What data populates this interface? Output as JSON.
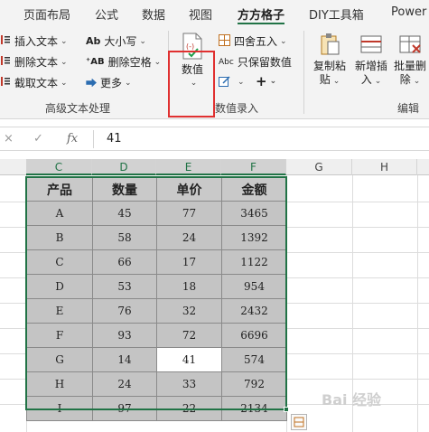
{
  "ribbon_tabs": [
    "页面布局",
    "公式",
    "数据",
    "视图",
    "方方格子",
    "DIY工具箱",
    "Power"
  ],
  "active_tab": "方方格子",
  "text_group": {
    "insert_text": "插入文本",
    "delete_text": "删除文本",
    "cut_text": "截取文本",
    "case": "大小写",
    "delete_spaces": "删除空格",
    "more": "更多",
    "label": "高级文本处理"
  },
  "numeric_group": {
    "values_button": "数值",
    "round": "四舍五入",
    "keep_values": "只保留数值",
    "label": "数值录入"
  },
  "edit_group": {
    "copy_paste_line1": "复制粘",
    "copy_paste_line2": "贴",
    "add_insert_line1": "新增插",
    "add_insert_line2": "入",
    "batch_delete_line1": "批量删",
    "batch_delete_line2": "除",
    "label": "编辑"
  },
  "formula_bar": {
    "cancel_icon": "×",
    "confirm_icon": "✓",
    "fx_label": "fx",
    "value": "41"
  },
  "columns": [
    "C",
    "D",
    "E",
    "F",
    "G",
    "H"
  ],
  "table": {
    "headers": [
      "产品",
      "数量",
      "单价",
      "金额"
    ],
    "rows": [
      [
        "A",
        "45",
        "77",
        "3465"
      ],
      [
        "B",
        "58",
        "24",
        "1392"
      ],
      [
        "C",
        "66",
        "17",
        "1122"
      ],
      [
        "D",
        "53",
        "18",
        "954"
      ],
      [
        "E",
        "76",
        "32",
        "2432"
      ],
      [
        "F",
        "93",
        "72",
        "6696"
      ],
      [
        "G",
        "14",
        "41",
        "574"
      ],
      [
        "H",
        "24",
        "33",
        "792"
      ],
      [
        "I",
        "97",
        "22",
        "2134"
      ]
    ]
  },
  "watermark": "Bai 经验",
  "colors": {
    "accent": "#217346",
    "highlight": "#e03030",
    "cell_fill": "#c4c4c4"
  }
}
